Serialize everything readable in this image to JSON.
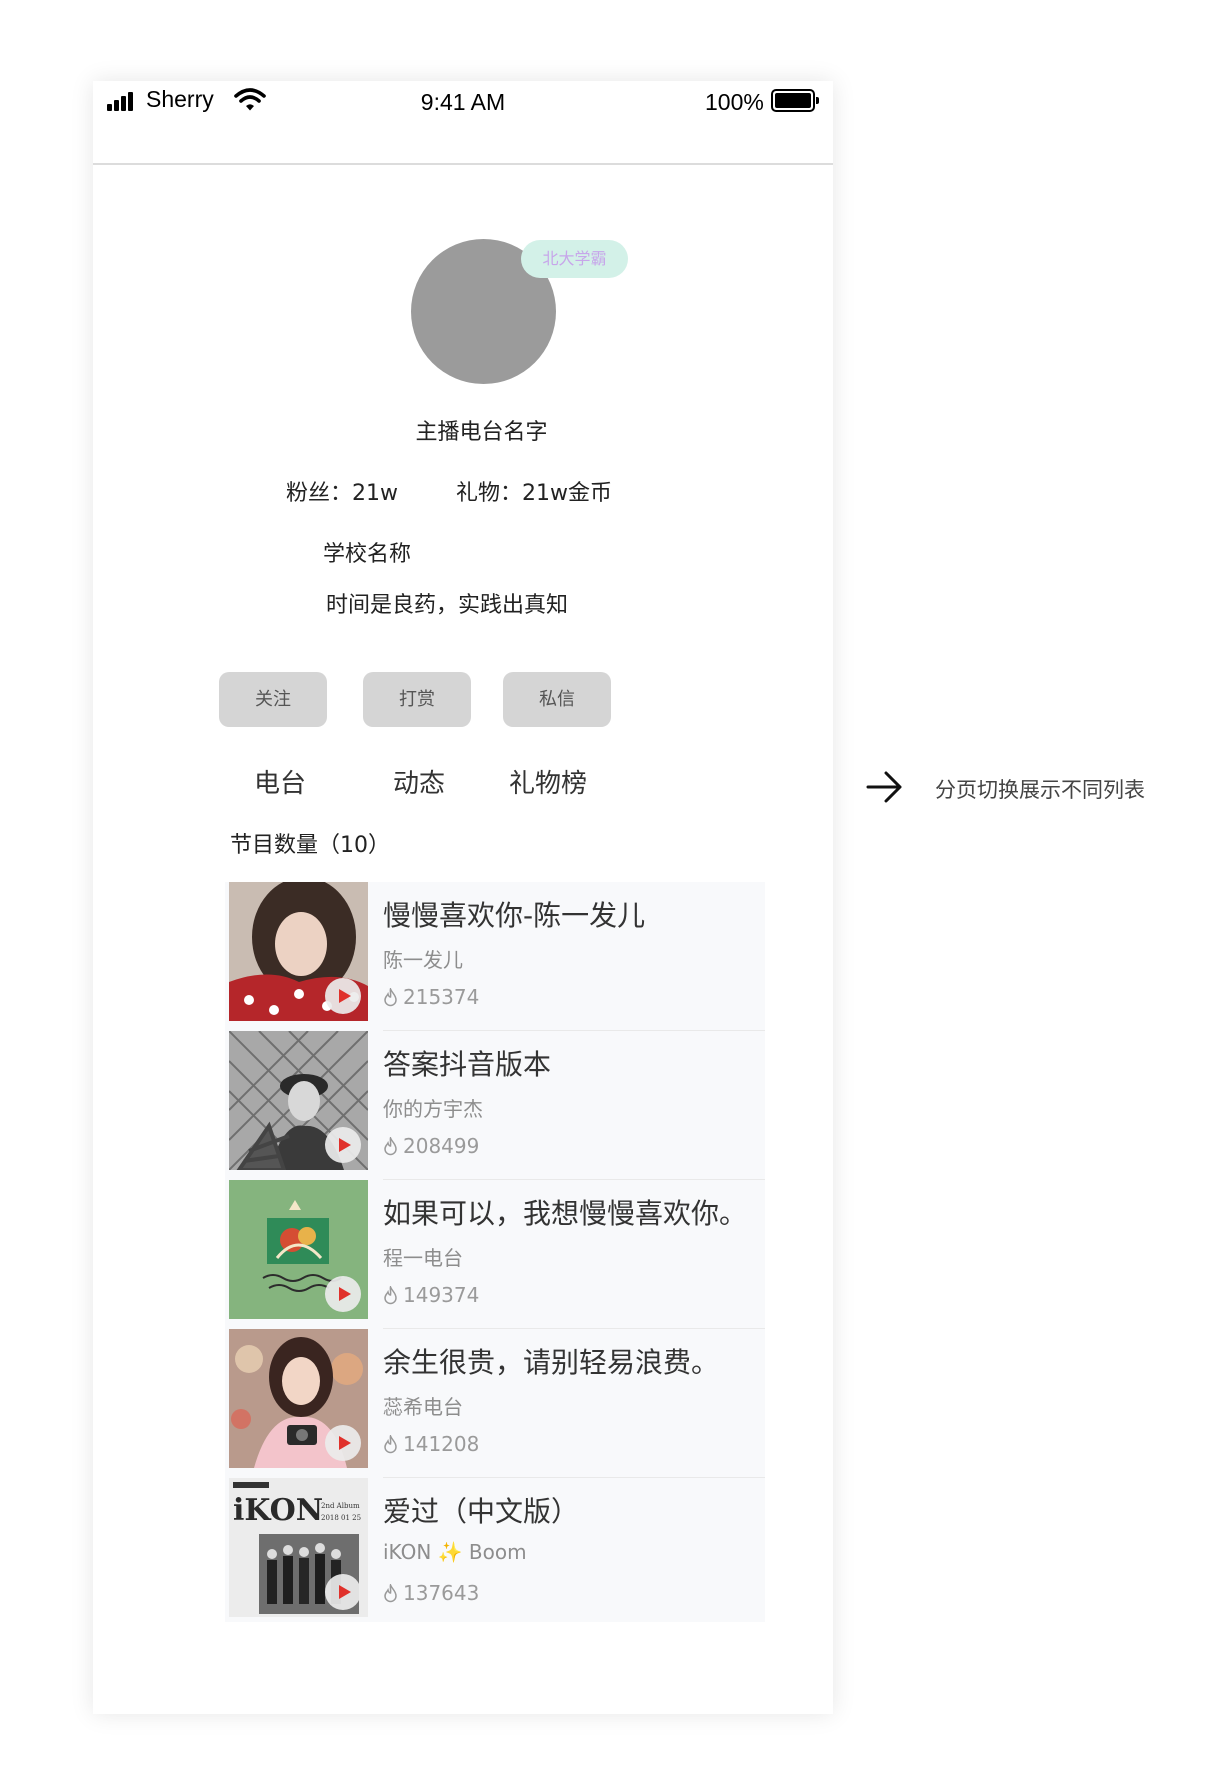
{
  "status_bar": {
    "carrier": "Sherry",
    "time": "9:41 AM",
    "battery": "100%"
  },
  "profile": {
    "badge": "北大学霸",
    "name": "主播电台名字",
    "fans": "粉丝：21w",
    "gifts": "礼物：21w金币",
    "school": "学校名称",
    "motto": "时间是良药，实践出真知"
  },
  "actions": {
    "follow": "关注",
    "reward": "打赏",
    "message": "私信"
  },
  "tabs": [
    "电台",
    "动态",
    "礼物榜"
  ],
  "program_count": "节目数量（10）",
  "programs": [
    {
      "title": "慢慢喜欢你-陈一发儿",
      "artist": "陈一发儿",
      "plays": "215374"
    },
    {
      "title": "答案抖音版本",
      "artist": "你的方宇杰",
      "plays": "208499"
    },
    {
      "title": "如果可以，我想慢慢喜欢你。",
      "artist": "程一电台",
      "plays": "149374"
    },
    {
      "title": "余生很贵，请别轻易浪费。",
      "artist": "蕊希电台",
      "plays": "141208"
    },
    {
      "title": "爱过（中文版）",
      "artist": "iKON ✨ Boom",
      "plays": "137643"
    }
  ],
  "annotation": {
    "note": "分页切换展示不同列表",
    "arrow_icon": "right-arrow-icon"
  },
  "colors": {
    "badge_bg": "#d3f1e8",
    "badge_text": "#c7a6ea",
    "avatar": "#9b9b9b",
    "button_bg": "#d5d5d5",
    "play_icon": "#e0312b"
  }
}
